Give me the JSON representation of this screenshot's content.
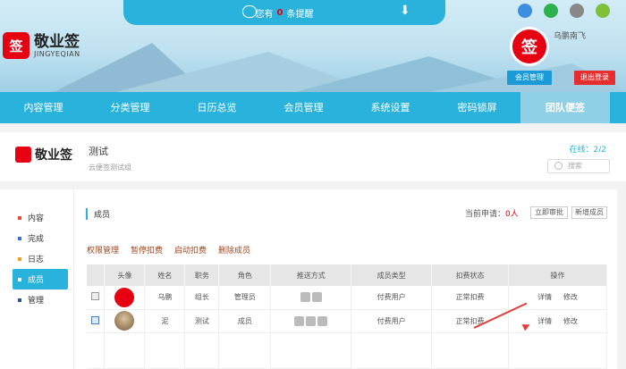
{
  "notify": {
    "prefix": "您有",
    "count": "0",
    "suffix": "条提醒"
  },
  "logo": {
    "cn": "敬业签",
    "en": "JINGYEQIAN"
  },
  "user": {
    "name": "乌鹏南飞",
    "member_label": "会员管理",
    "logout_label": "退出登录"
  },
  "nav": [
    "内容管理",
    "分类管理",
    "日历总览",
    "会员管理",
    "系统设置",
    "密码锁屏",
    "团队便签"
  ],
  "team": {
    "logo_cn": "敬业签",
    "title": "测试",
    "subtitle": "云便签测试组",
    "online": "在线：2/2",
    "search_placeholder": "搜索"
  },
  "sidebar": [
    {
      "label": "内容",
      "color": "#e64a3a"
    },
    {
      "label": "完成",
      "color": "#3a6fd8"
    },
    {
      "label": "日志",
      "color": "#f0a020"
    },
    {
      "label": "成员",
      "color": "#ffffff"
    },
    {
      "label": "管理",
      "color": "#2a4ea8"
    }
  ],
  "main": {
    "title": "成员",
    "pending_label": "当前申请：",
    "pending_count": "0人",
    "review_btn": "立即审批",
    "add_btn": "新增成员",
    "actions": [
      "权限管理",
      "暂停扣费",
      "启动扣费",
      "删除成员"
    ],
    "columns": [
      "",
      "头像",
      "姓名",
      "职务",
      "角色",
      "推送方式",
      "成员类型",
      "扣费状态",
      "操作"
    ],
    "rows": [
      {
        "name": "乌鹏",
        "job": "组长",
        "role": "管理员",
        "type": "付费用户",
        "status": "正常扣费",
        "detail": "详情",
        "edit": "修改"
      },
      {
        "name": "泥",
        "job": "测试",
        "role": "成员",
        "type": "付费用户",
        "status": "正常扣费",
        "detail": "详情",
        "edit": "修改"
      }
    ]
  }
}
